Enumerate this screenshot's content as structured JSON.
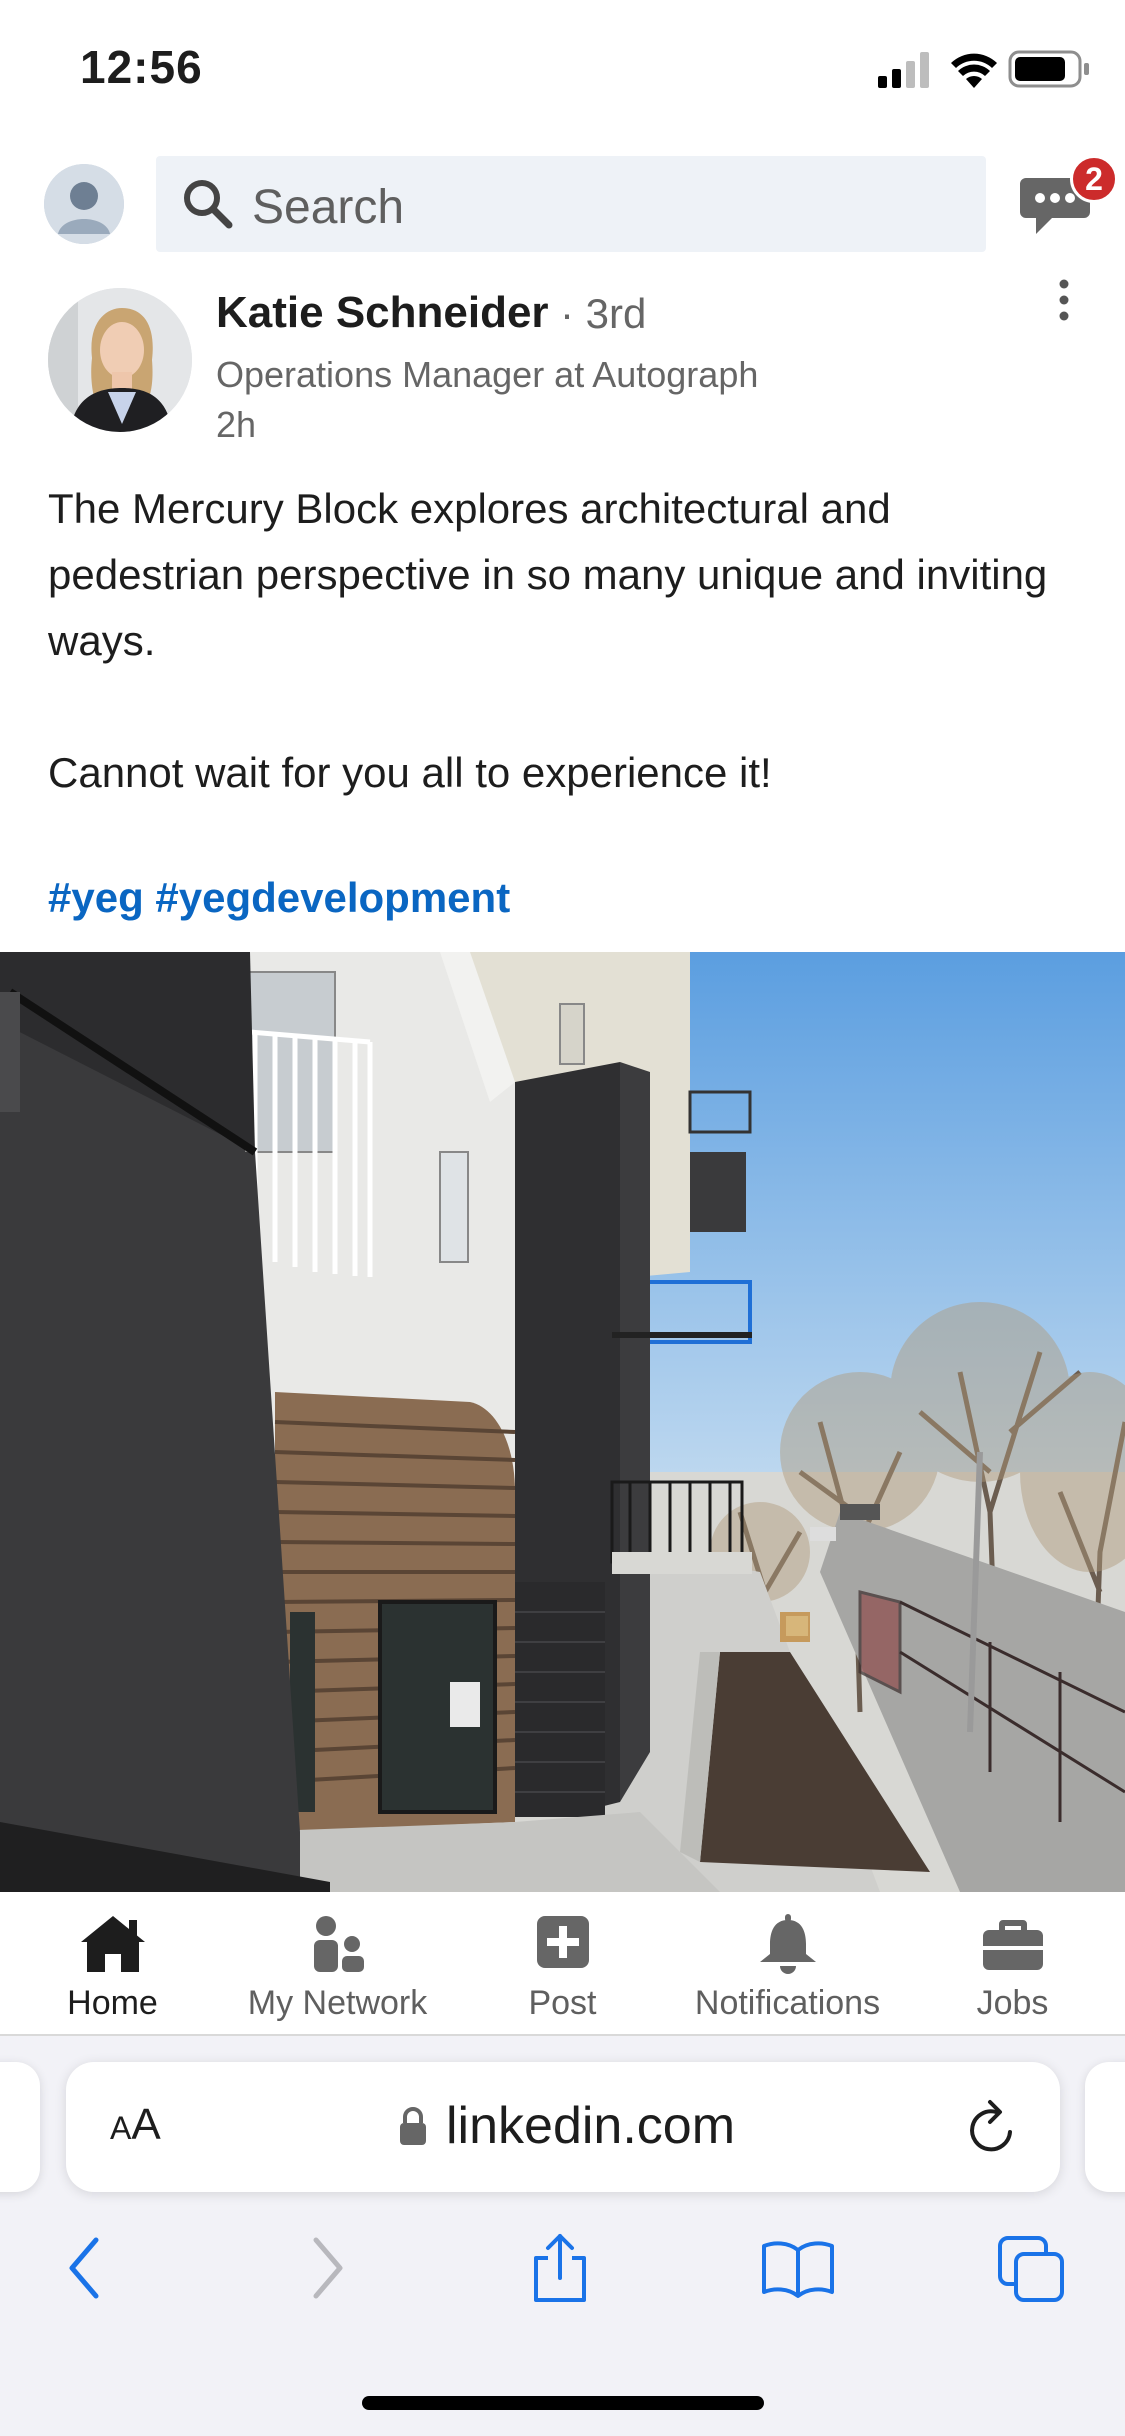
{
  "status_bar": {
    "time": "12:56"
  },
  "top_bar": {
    "search_placeholder": "Search",
    "messages_badge": "2"
  },
  "post": {
    "author_name": "Katie Schneider",
    "connection_degree": "· 3rd",
    "author_headline": "Operations Manager at Autograph",
    "timestamp": "2h",
    "text_line1": "The Mercury Block explores architectural and pedestrian perspective in so many unique and inviting ways.",
    "text_line2": "Cannot wait for you all to experience it!",
    "hashtags": "#yeg #yegdevelopment"
  },
  "bottom_nav": {
    "items": [
      {
        "label": "Home",
        "icon": "home-icon",
        "active": true
      },
      {
        "label": "My Network",
        "icon": "my-network-icon",
        "active": false
      },
      {
        "label": "Post",
        "icon": "post-plus-icon",
        "active": false
      },
      {
        "label": "Notifications",
        "icon": "bell-icon",
        "active": false
      },
      {
        "label": "Jobs",
        "icon": "briefcase-icon",
        "active": false
      }
    ]
  },
  "browser": {
    "aa_large": "A",
    "aa_small": "A",
    "url": "linkedin.com"
  },
  "colors": {
    "link_blue": "#0a66c2",
    "badge_red": "#cc2b2b",
    "ios_blue": "#1a73e8",
    "nav_gray": "#5f5f5f"
  }
}
